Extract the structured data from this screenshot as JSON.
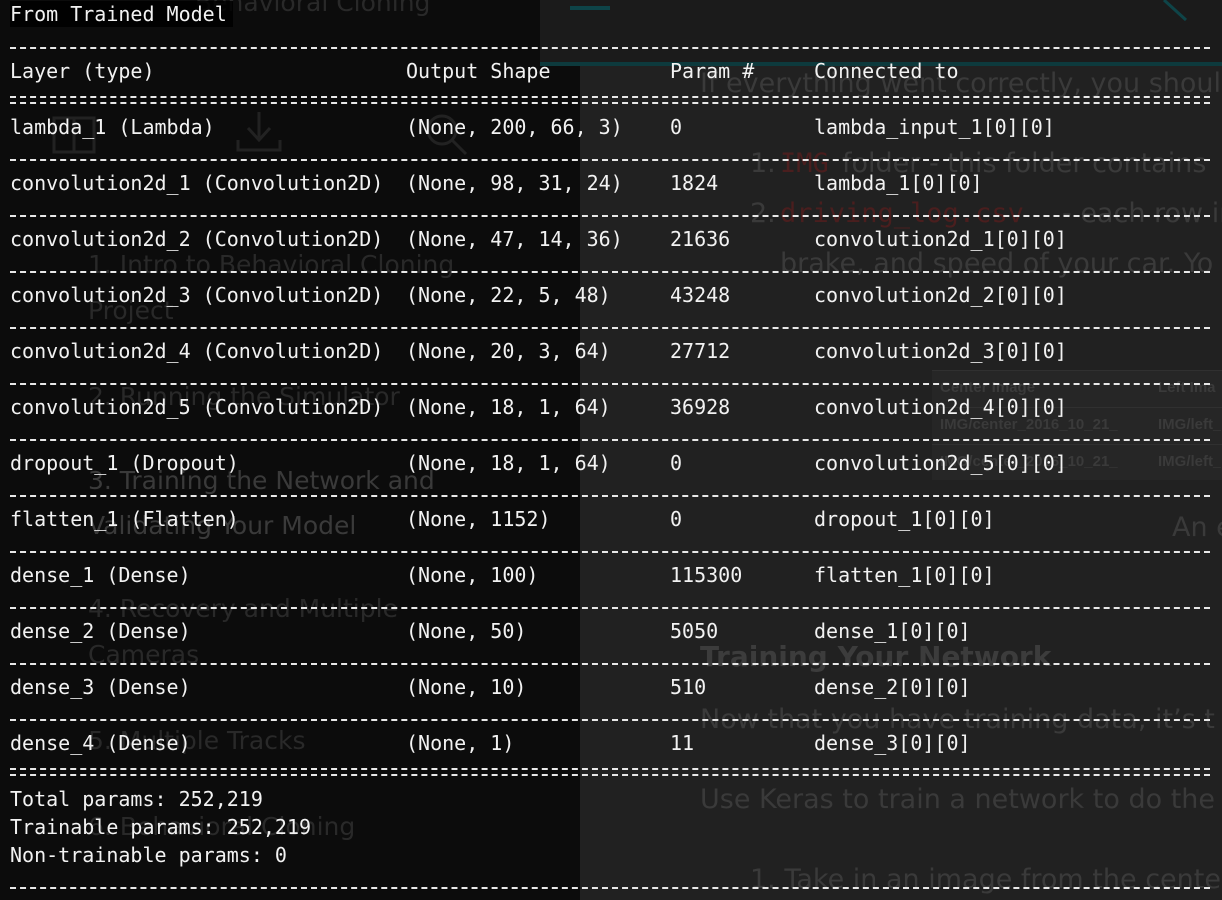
{
  "background_page": {
    "header_partial": "Behavioral Cloning",
    "sidebar_items": [
      "1. Intro to Behavioral Cloning",
      "Project",
      "2. Running the Simulator",
      "3. Training the Network and",
      "Validating Your Model",
      "4. Recovery and Multiple",
      "Cameras",
      "5. Multiple Tracks",
      "6. Behavioral Cloning"
    ],
    "main_intro": "If everything went correctly, you should",
    "list_item_1_code": "IMG",
    "list_item_1_text": "folder - this folder contains",
    "list_item_2_code": "driving_log.csv",
    "list_item_2_text": "- each row in",
    "list_item_2_cont": "brake, and speed of your car. Yo",
    "table_headers": [
      "Center Image",
      "Left Ima"
    ],
    "table_rows": [
      [
        "IMG/center_2016_10_21_",
        "IMG/left_"
      ],
      [
        "IMG/center_2016_10_21_",
        "IMG/left_"
      ]
    ],
    "caption_partial": "An e",
    "section_heading": "Training Your Network",
    "para_1": "Now that you have training data, it’s t",
    "para_2": "Use Keras to train a network to do the",
    "step_1": "1. Take in an image from the cente"
  },
  "terminal": {
    "title": "From Trained Model",
    "headers": {
      "layer": "Layer (type)",
      "shape": "Output Shape",
      "param": "Param #",
      "connected": "Connected to"
    },
    "rows": [
      {
        "layer": "lambda_1 (Lambda)",
        "shape": "(None, 200, 66, 3)",
        "param": "0",
        "connected": "lambda_input_1[0][0]"
      },
      {
        "layer": "convolution2d_1 (Convolution2D)",
        "shape": "(None, 98, 31, 24)",
        "param": "1824",
        "connected": "lambda_1[0][0]"
      },
      {
        "layer": "convolution2d_2 (Convolution2D)",
        "shape": "(None, 47, 14, 36)",
        "param": "21636",
        "connected": "convolution2d_1[0][0]"
      },
      {
        "layer": "convolution2d_3 (Convolution2D)",
        "shape": "(None, 22, 5, 48)",
        "param": "43248",
        "connected": "convolution2d_2[0][0]"
      },
      {
        "layer": "convolution2d_4 (Convolution2D)",
        "shape": "(None, 20, 3, 64)",
        "param": "27712",
        "connected": "convolution2d_3[0][0]"
      },
      {
        "layer": "convolution2d_5 (Convolution2D)",
        "shape": "(None, 18, 1, 64)",
        "param": "36928",
        "connected": "convolution2d_4[0][0]"
      },
      {
        "layer": "dropout_1 (Dropout)",
        "shape": "(None, 18, 1, 64)",
        "param": "0",
        "connected": "convolution2d_5[0][0]"
      },
      {
        "layer": "flatten_1 (Flatten)",
        "shape": "(None, 1152)",
        "param": "0",
        "connected": "dropout_1[0][0]"
      },
      {
        "layer": "dense_1 (Dense)",
        "shape": "(None, 100)",
        "param": "115300",
        "connected": "flatten_1[0][0]"
      },
      {
        "layer": "dense_2 (Dense)",
        "shape": "(None, 50)",
        "param": "5050",
        "connected": "dense_1[0][0]"
      },
      {
        "layer": "dense_3 (Dense)",
        "shape": "(None, 10)",
        "param": "510",
        "connected": "dense_2[0][0]"
      },
      {
        "layer": "dense_4 (Dense)",
        "shape": "(None, 1)",
        "param": "11",
        "connected": "dense_3[0][0]"
      }
    ],
    "summary": {
      "total": "Total params: 252,219",
      "trainable": "Trainable params: 252,219",
      "non_trainable": "Non-trainable params: 0"
    }
  },
  "colors": {
    "terminal_text": "#f2f2f2",
    "background_page_text": "#3a3a3a",
    "code_red": "#4a1e1e",
    "topbar_accent": "#0d3a3d"
  }
}
